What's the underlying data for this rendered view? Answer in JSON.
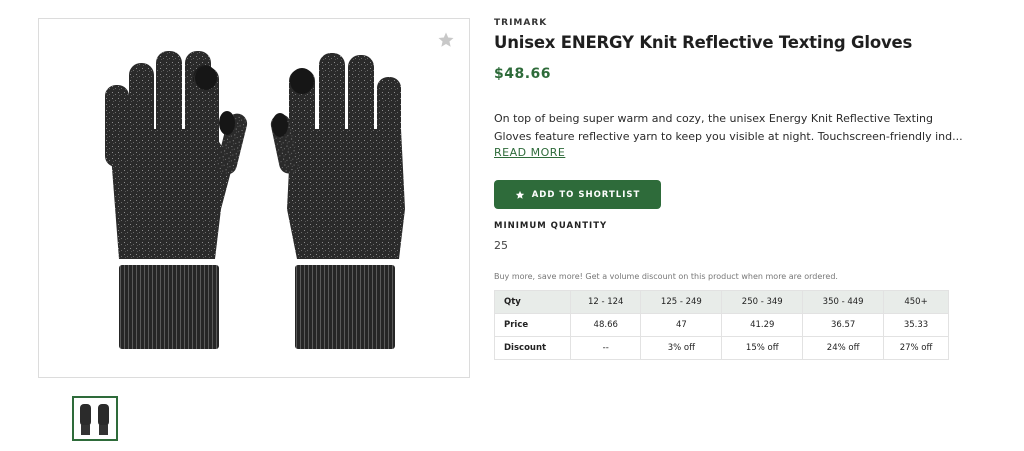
{
  "product": {
    "brand": "TRIMARK",
    "title": "Unisex ENERGY Knit Reflective Texting Gloves",
    "price": "$48.66",
    "description_line1": "On top of being super warm and cozy, the unisex Energy Knit Reflective Texting",
    "description_line2": "Gloves feature reflective yarn to keep you visible at night. Touchscreen-friendly ind...",
    "read_more": "READ MORE",
    "shortlist_button": "ADD TO SHORTLIST",
    "min_quantity_label": "MINIMUM QUANTITY",
    "min_quantity_value": "25",
    "volume_note": "Buy more, save more! Get a volume discount on this product when more are ordered."
  },
  "pricing_table": {
    "headers": [
      "Qty",
      "12 - 124",
      "125 - 249",
      "250 - 349",
      "350 - 449",
      "450+"
    ],
    "rows": [
      [
        "Price",
        "48.66",
        "47",
        "41.29",
        "36.57",
        "35.33"
      ],
      [
        "Discount",
        "--",
        "3% off",
        "15% off",
        "24% off",
        "27% off"
      ]
    ]
  },
  "icons": {
    "favorite": "star-icon",
    "shortlist": "star-icon"
  },
  "colors": {
    "accent": "#2e6b3a",
    "table_header_bg": "#e8ece9",
    "glove_body": "#2b2b2b"
  }
}
